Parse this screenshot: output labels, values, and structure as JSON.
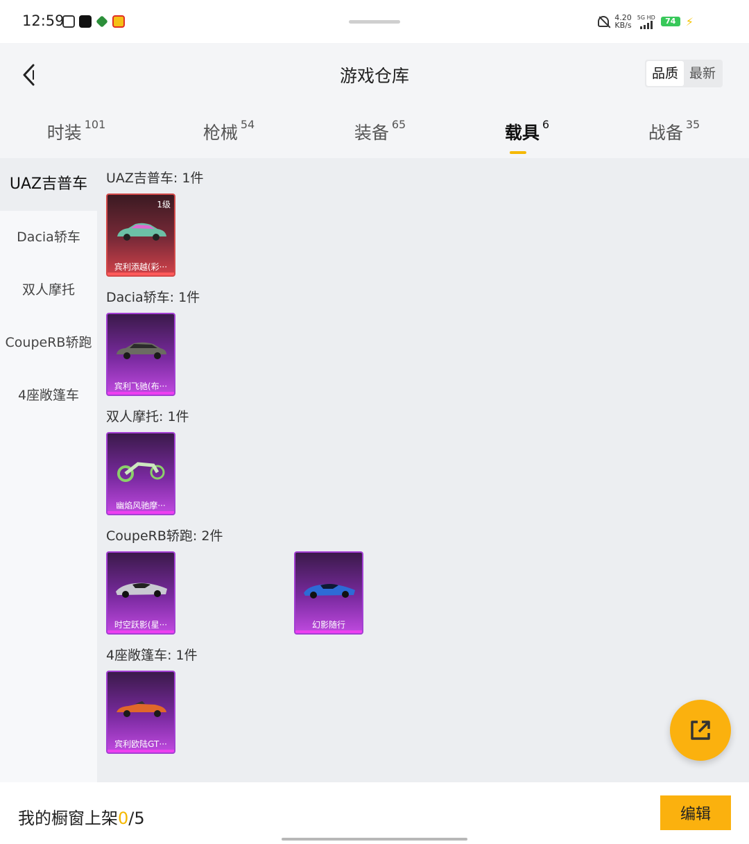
{
  "status_bar": {
    "time": "12:59",
    "net_speed_value": "4.20",
    "net_speed_unit": "KB/s",
    "signal_label": "5G HD",
    "battery": "74"
  },
  "header": {
    "title": "游戏仓库",
    "sort": {
      "quality": "品质",
      "newest": "最新",
      "active": "品质"
    }
  },
  "tabs": [
    {
      "label": "时装",
      "count": "101"
    },
    {
      "label": "枪械",
      "count": "54"
    },
    {
      "label": "装备",
      "count": "65"
    },
    {
      "label": "载具",
      "count": "6",
      "active": true
    },
    {
      "label": "战备",
      "count": "35"
    }
  ],
  "sidebar": {
    "items": [
      {
        "label": "UAZ吉普车",
        "active": true
      },
      {
        "label": "Dacia轿车"
      },
      {
        "label": "双人摩托"
      },
      {
        "label": "CoupeRB轿跑"
      },
      {
        "label": "4座敞篷车"
      }
    ]
  },
  "groups": [
    {
      "title": "UAZ吉普车: 1件",
      "items": [
        {
          "name": "宾利添越(彩···",
          "level": "1级",
          "rarity": "red",
          "car_color": "#6a9"
        }
      ]
    },
    {
      "title": "Dacia轿车: 1件",
      "items": [
        {
          "name": "宾利飞驰(布···",
          "rarity": "purple",
          "car_color": "#6b6b62"
        }
      ]
    },
    {
      "title": "双人摩托: 1件",
      "items": [
        {
          "name": "幽焰风驰摩···",
          "rarity": "purple",
          "car_color": "#8bd06a"
        }
      ]
    },
    {
      "title": "CoupeRB轿跑: 2件",
      "items": [
        {
          "name": "时空跃影(星···",
          "rarity": "purple",
          "car_color": "#c9c9d2"
        },
        {
          "name": "幻影随行",
          "rarity": "purple",
          "car_color": "#2d6bd6"
        }
      ]
    },
    {
      "title": "4座敞篷车: 1件",
      "items": [
        {
          "name": "宾利欧陆GT···",
          "rarity": "purple",
          "car_color": "#e0682a"
        }
      ]
    }
  ],
  "bottom_bar": {
    "shelf_label": "我的橱窗上架",
    "shelf_current": "0",
    "shelf_total": "/5",
    "edit_label": "编辑"
  }
}
